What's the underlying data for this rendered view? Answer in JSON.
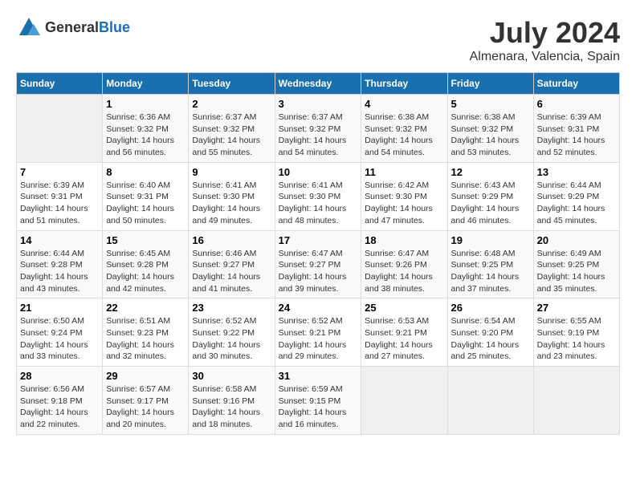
{
  "header": {
    "logo_general": "General",
    "logo_blue": "Blue",
    "title": "July 2024",
    "location": "Almenara, Valencia, Spain"
  },
  "days_of_week": [
    "Sunday",
    "Monday",
    "Tuesday",
    "Wednesday",
    "Thursday",
    "Friday",
    "Saturday"
  ],
  "weeks": [
    [
      {
        "day": "",
        "sunrise": "",
        "sunset": "",
        "daylight": "",
        "empty": true
      },
      {
        "day": "1",
        "sunrise": "Sunrise: 6:36 AM",
        "sunset": "Sunset: 9:32 PM",
        "daylight": "Daylight: 14 hours and 56 minutes."
      },
      {
        "day": "2",
        "sunrise": "Sunrise: 6:37 AM",
        "sunset": "Sunset: 9:32 PM",
        "daylight": "Daylight: 14 hours and 55 minutes."
      },
      {
        "day": "3",
        "sunrise": "Sunrise: 6:37 AM",
        "sunset": "Sunset: 9:32 PM",
        "daylight": "Daylight: 14 hours and 54 minutes."
      },
      {
        "day": "4",
        "sunrise": "Sunrise: 6:38 AM",
        "sunset": "Sunset: 9:32 PM",
        "daylight": "Daylight: 14 hours and 54 minutes."
      },
      {
        "day": "5",
        "sunrise": "Sunrise: 6:38 AM",
        "sunset": "Sunset: 9:32 PM",
        "daylight": "Daylight: 14 hours and 53 minutes."
      },
      {
        "day": "6",
        "sunrise": "Sunrise: 6:39 AM",
        "sunset": "Sunset: 9:31 PM",
        "daylight": "Daylight: 14 hours and 52 minutes."
      }
    ],
    [
      {
        "day": "7",
        "sunrise": "Sunrise: 6:39 AM",
        "sunset": "Sunset: 9:31 PM",
        "daylight": "Daylight: 14 hours and 51 minutes."
      },
      {
        "day": "8",
        "sunrise": "Sunrise: 6:40 AM",
        "sunset": "Sunset: 9:31 PM",
        "daylight": "Daylight: 14 hours and 50 minutes."
      },
      {
        "day": "9",
        "sunrise": "Sunrise: 6:41 AM",
        "sunset": "Sunset: 9:30 PM",
        "daylight": "Daylight: 14 hours and 49 minutes."
      },
      {
        "day": "10",
        "sunrise": "Sunrise: 6:41 AM",
        "sunset": "Sunset: 9:30 PM",
        "daylight": "Daylight: 14 hours and 48 minutes."
      },
      {
        "day": "11",
        "sunrise": "Sunrise: 6:42 AM",
        "sunset": "Sunset: 9:30 PM",
        "daylight": "Daylight: 14 hours and 47 minutes."
      },
      {
        "day": "12",
        "sunrise": "Sunrise: 6:43 AM",
        "sunset": "Sunset: 9:29 PM",
        "daylight": "Daylight: 14 hours and 46 minutes."
      },
      {
        "day": "13",
        "sunrise": "Sunrise: 6:44 AM",
        "sunset": "Sunset: 9:29 PM",
        "daylight": "Daylight: 14 hours and 45 minutes."
      }
    ],
    [
      {
        "day": "14",
        "sunrise": "Sunrise: 6:44 AM",
        "sunset": "Sunset: 9:28 PM",
        "daylight": "Daylight: 14 hours and 43 minutes."
      },
      {
        "day": "15",
        "sunrise": "Sunrise: 6:45 AM",
        "sunset": "Sunset: 9:28 PM",
        "daylight": "Daylight: 14 hours and 42 minutes."
      },
      {
        "day": "16",
        "sunrise": "Sunrise: 6:46 AM",
        "sunset": "Sunset: 9:27 PM",
        "daylight": "Daylight: 14 hours and 41 minutes."
      },
      {
        "day": "17",
        "sunrise": "Sunrise: 6:47 AM",
        "sunset": "Sunset: 9:27 PM",
        "daylight": "Daylight: 14 hours and 39 minutes."
      },
      {
        "day": "18",
        "sunrise": "Sunrise: 6:47 AM",
        "sunset": "Sunset: 9:26 PM",
        "daylight": "Daylight: 14 hours and 38 minutes."
      },
      {
        "day": "19",
        "sunrise": "Sunrise: 6:48 AM",
        "sunset": "Sunset: 9:25 PM",
        "daylight": "Daylight: 14 hours and 37 minutes."
      },
      {
        "day": "20",
        "sunrise": "Sunrise: 6:49 AM",
        "sunset": "Sunset: 9:25 PM",
        "daylight": "Daylight: 14 hours and 35 minutes."
      }
    ],
    [
      {
        "day": "21",
        "sunrise": "Sunrise: 6:50 AM",
        "sunset": "Sunset: 9:24 PM",
        "daylight": "Daylight: 14 hours and 33 minutes."
      },
      {
        "day": "22",
        "sunrise": "Sunrise: 6:51 AM",
        "sunset": "Sunset: 9:23 PM",
        "daylight": "Daylight: 14 hours and 32 minutes."
      },
      {
        "day": "23",
        "sunrise": "Sunrise: 6:52 AM",
        "sunset": "Sunset: 9:22 PM",
        "daylight": "Daylight: 14 hours and 30 minutes."
      },
      {
        "day": "24",
        "sunrise": "Sunrise: 6:52 AM",
        "sunset": "Sunset: 9:21 PM",
        "daylight": "Daylight: 14 hours and 29 minutes."
      },
      {
        "day": "25",
        "sunrise": "Sunrise: 6:53 AM",
        "sunset": "Sunset: 9:21 PM",
        "daylight": "Daylight: 14 hours and 27 minutes."
      },
      {
        "day": "26",
        "sunrise": "Sunrise: 6:54 AM",
        "sunset": "Sunset: 9:20 PM",
        "daylight": "Daylight: 14 hours and 25 minutes."
      },
      {
        "day": "27",
        "sunrise": "Sunrise: 6:55 AM",
        "sunset": "Sunset: 9:19 PM",
        "daylight": "Daylight: 14 hours and 23 minutes."
      }
    ],
    [
      {
        "day": "28",
        "sunrise": "Sunrise: 6:56 AM",
        "sunset": "Sunset: 9:18 PM",
        "daylight": "Daylight: 14 hours and 22 minutes."
      },
      {
        "day": "29",
        "sunrise": "Sunrise: 6:57 AM",
        "sunset": "Sunset: 9:17 PM",
        "daylight": "Daylight: 14 hours and 20 minutes."
      },
      {
        "day": "30",
        "sunrise": "Sunrise: 6:58 AM",
        "sunset": "Sunset: 9:16 PM",
        "daylight": "Daylight: 14 hours and 18 minutes."
      },
      {
        "day": "31",
        "sunrise": "Sunrise: 6:59 AM",
        "sunset": "Sunset: 9:15 PM",
        "daylight": "Daylight: 14 hours and 16 minutes."
      },
      {
        "day": "",
        "sunrise": "",
        "sunset": "",
        "daylight": "",
        "empty": true
      },
      {
        "day": "",
        "sunrise": "",
        "sunset": "",
        "daylight": "",
        "empty": true
      },
      {
        "day": "",
        "sunrise": "",
        "sunset": "",
        "daylight": "",
        "empty": true
      }
    ]
  ]
}
